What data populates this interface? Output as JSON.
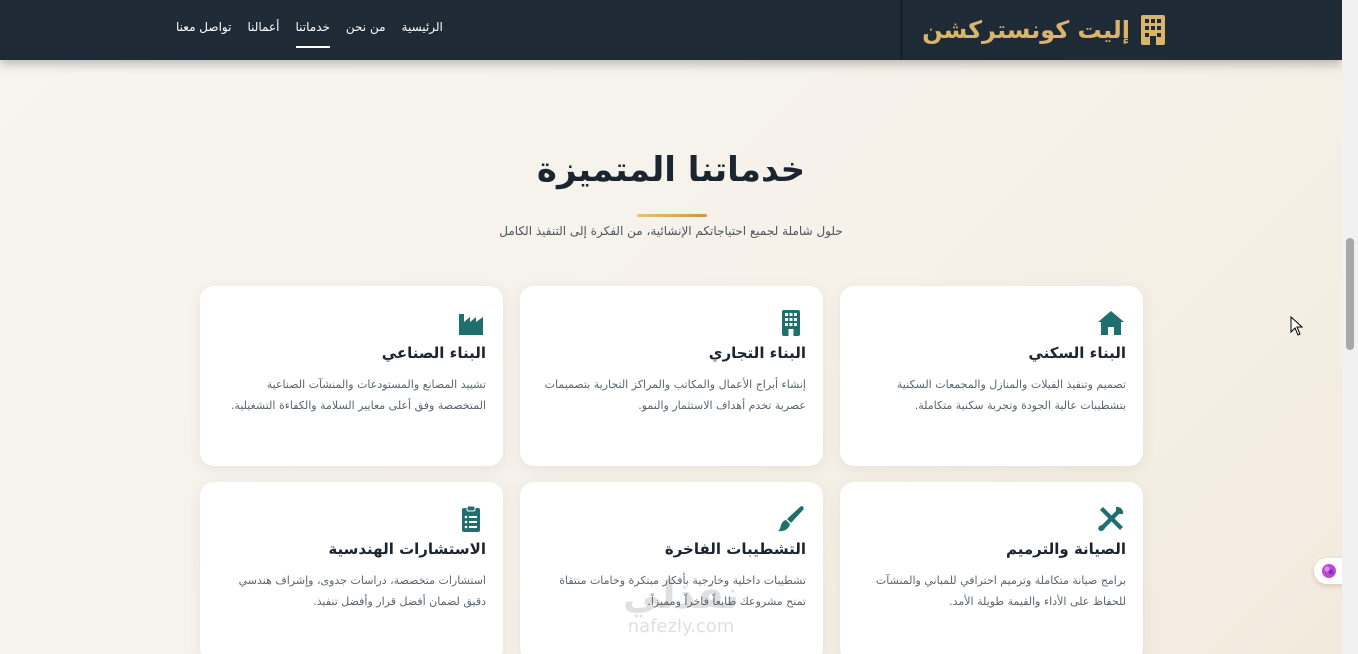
{
  "brand": {
    "name": "إليت كونستركشن",
    "icon": "building-icon",
    "color": "#d9b46a"
  },
  "nav": {
    "items": [
      {
        "label": "الرئيسية",
        "active": false
      },
      {
        "label": "من نحن",
        "active": false
      },
      {
        "label": "خدماتنا",
        "active": true
      },
      {
        "label": "أعمالنا",
        "active": false
      },
      {
        "label": "تواصل معنا",
        "active": false
      }
    ]
  },
  "section": {
    "title": "خدماتنا المتميزة",
    "subtitle": "حلول شاملة لجميع احتياجاتكم الإنشائية، من الفكرة إلى التنفيذ الكامل"
  },
  "services": [
    {
      "title": "البناء السكني",
      "icon": "home-icon",
      "desc": "تصميم وتنفيذ الفيلات والمنازل والمجمعات السكنية بتشطيبات عالية الجودة وتجربة سكنية متكاملة."
    },
    {
      "title": "البناء التجاري",
      "icon": "office-building-icon",
      "desc": "إنشاء أبراج الأعمال والمكاتب والمراكز التجارية بتصميمات عصرية تخدم أهداف الاستثمار والنمو."
    },
    {
      "title": "البناء الصناعي",
      "icon": "factory-icon",
      "desc": "تشييد المصانع والمستودعات والمنشآت الصناعية المتخصصة وفق أعلى معايير السلامة والكفاءة التشغيلية."
    },
    {
      "title": "الصيانة والترميم",
      "icon": "tools-icon",
      "desc": "برامج صيانة متكاملة وترميم احترافي للمباني والمنشآت للحفاظ على الأداء والقيمة طويلة الأمد."
    },
    {
      "title": "التشطيبات الفاخرة",
      "icon": "paint-brush-icon",
      "desc": "تشطيبات داخلية وخارجية بأفكار مبتكرة وخامات منتقاة تمنح مشروعك طابعاً فاخراً ومميزاً."
    },
    {
      "title": "الاستشارات الهندسية",
      "icon": "clipboard-list-icon",
      "desc": "استشارات متخصصة، دراسات جدوى، وإشراف هندسي دقيق لضمان أفضل قرار وأفضل تنفيذ."
    }
  ],
  "watermark": {
    "line1": "نفذلي",
    "line2": "nafezly.com"
  },
  "colors": {
    "accent": "#1f6f6f",
    "header": "#1e2a35",
    "gold": "#d9b46a"
  }
}
